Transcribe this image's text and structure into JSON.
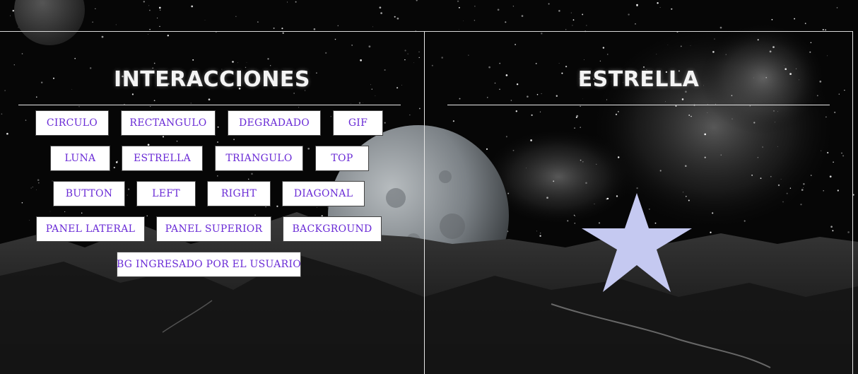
{
  "left_panel": {
    "title": "INTERACCIONES",
    "buttons": [
      {
        "label": "CIRCULO"
      },
      {
        "label": "RECTANGULO"
      },
      {
        "label": "DEGRADADO"
      },
      {
        "label": "GIF"
      },
      {
        "label": "LUNA"
      },
      {
        "label": "ESTRELLA"
      },
      {
        "label": "TRIANGULO"
      },
      {
        "label": "TOP"
      },
      {
        "label": "BUTTON"
      },
      {
        "label": "LEFT"
      },
      {
        "label": "RIGHT"
      },
      {
        "label": "DIAGONAL"
      },
      {
        "label": "PANEL LATERAL"
      },
      {
        "label": "PANEL SUPERIOR"
      },
      {
        "label": "BACKGROUND"
      },
      {
        "label": "BG INGRESADO POR EL USUARIO"
      }
    ]
  },
  "right_panel": {
    "title": "ESTRELLA",
    "shape_color": "#c5c9f1"
  },
  "colors": {
    "button_text": "#6a2bd6",
    "button_bg": "#ffffff",
    "title_text": "#f4f4f4"
  }
}
